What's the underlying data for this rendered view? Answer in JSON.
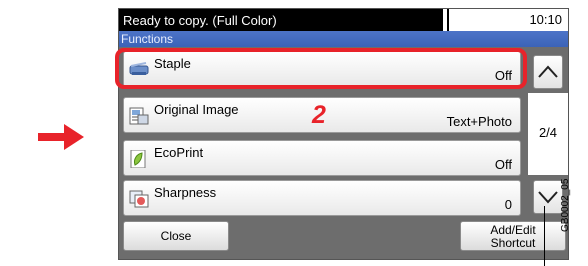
{
  "status": {
    "message": "Ready to copy. (Full Color)",
    "time": "10:10"
  },
  "panel": {
    "title": "Functions"
  },
  "items": [
    {
      "label": "Staple",
      "value": "Off",
      "icon": "staple-icon"
    },
    {
      "label": "Original Image",
      "value": "Text+Photo",
      "icon": "original-image-icon"
    },
    {
      "label": "EcoPrint",
      "value": "Off",
      "icon": "ecoprint-leaf-icon"
    },
    {
      "label": "Sharpness",
      "value": "0",
      "icon": "sharpness-icon"
    }
  ],
  "page_indicator": "2/4",
  "buttons": {
    "close": "Close",
    "add_edit_line1": "Add/Edit",
    "add_edit_line2": "Shortcut"
  },
  "callout_number": "2",
  "figure_code": "GB0002_05",
  "colors": {
    "callout_red": "#e8232a",
    "title_blue": "#4d74c8"
  }
}
